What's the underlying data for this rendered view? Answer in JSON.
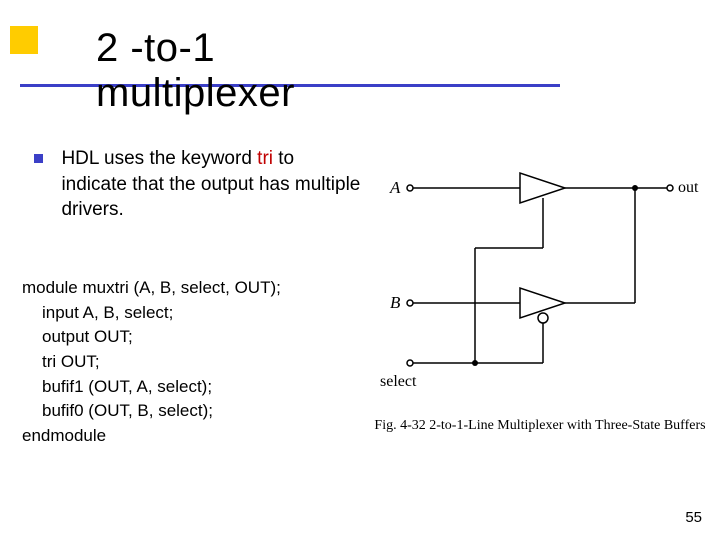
{
  "title": "2 -to-1 multiplexer",
  "bullet": {
    "pre": "HDL uses the keyword ",
    "tri": "tri",
    "post": " to indicate that the output has multiple drivers."
  },
  "code": {
    "l1": "module muxtri (A, B, select, OUT);",
    "l2": "input A, B, select;",
    "l3": "output OUT;",
    "l4": "tri OUT;",
    "l5": "bufif1 (OUT, A, select);",
    "l6": "bufif0 (OUT, B, select);",
    "l7": "endmodule"
  },
  "figure": {
    "label_A": "A",
    "label_B": "B",
    "label_out": "out",
    "label_select": "select",
    "caption": "Fig. 4-32  2-to-1-Line Multiplexer with Three-State Buffers"
  },
  "page_number": "55"
}
